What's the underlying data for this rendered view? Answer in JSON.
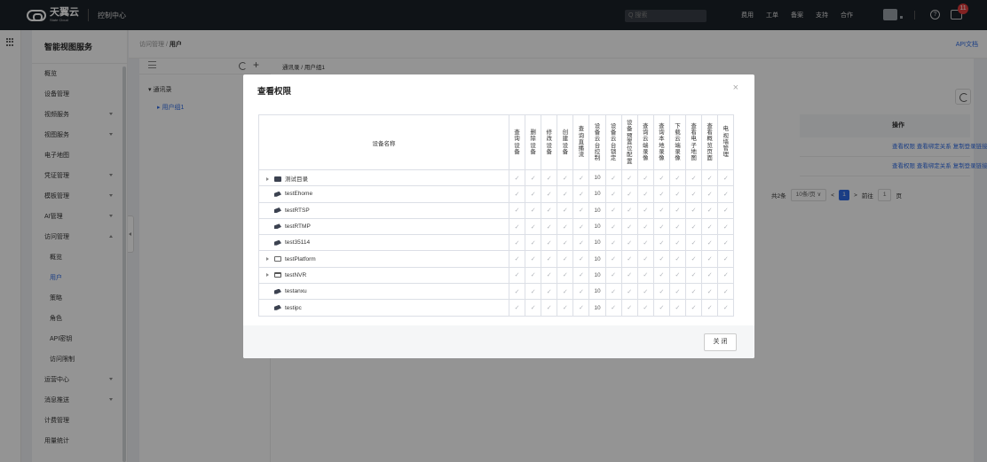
{
  "topbar": {
    "brand_cn": "天翼云",
    "brand_en": "State Cloud",
    "console": "控制中心",
    "search_placeholder": "搜索",
    "nav": [
      "费用",
      "工单",
      "备案",
      "支持",
      "合作"
    ],
    "help_glyph": "?",
    "msg_badge": "11"
  },
  "sidebar": {
    "title": "智能视图服务",
    "items": [
      {
        "label": "概览",
        "sub": false,
        "caret": ""
      },
      {
        "label": "设备管理",
        "sub": false,
        "caret": ""
      },
      {
        "label": "视频服务",
        "sub": false,
        "caret": "down"
      },
      {
        "label": "视图服务",
        "sub": false,
        "caret": "down"
      },
      {
        "label": "电子地图",
        "sub": false,
        "caret": ""
      },
      {
        "label": "凭证管理",
        "sub": false,
        "caret": "down"
      },
      {
        "label": "模板管理",
        "sub": false,
        "caret": "down"
      },
      {
        "label": "AI管理",
        "sub": false,
        "caret": "down"
      },
      {
        "label": "访问管理",
        "sub": false,
        "caret": "up"
      },
      {
        "label": "概览",
        "sub": true,
        "caret": ""
      },
      {
        "label": "用户",
        "sub": true,
        "caret": "",
        "active": true
      },
      {
        "label": "策略",
        "sub": true,
        "caret": ""
      },
      {
        "label": "角色",
        "sub": true,
        "caret": ""
      },
      {
        "label": "API密钥",
        "sub": true,
        "caret": ""
      },
      {
        "label": "访问限制",
        "sub": true,
        "caret": ""
      },
      {
        "label": "运营中心",
        "sub": false,
        "caret": "down"
      },
      {
        "label": "消息推送",
        "sub": false,
        "caret": "down"
      },
      {
        "label": "计费管理",
        "sub": false,
        "caret": ""
      },
      {
        "label": "用量统计",
        "sub": false,
        "caret": ""
      }
    ]
  },
  "breadcrumb": {
    "parent": "访问管理",
    "sep": " / ",
    "current": "用户"
  },
  "api_doc": "API文档",
  "tree": {
    "crumb": "通讯录 / 用户组1",
    "root": "▾  通讯录",
    "child": "▸  用户组1"
  },
  "bg_table": {
    "op_header": "操作",
    "row_actions": "查看权限    查看绑定关系    复制登录链接    更多 ∨"
  },
  "pager": {
    "total": "共2条",
    "page_size": "10条/页  ∨",
    "prev": "<",
    "page": "1",
    "next": ">",
    "goto": "前往",
    "goto_val": "1",
    "page_suffix": "页"
  },
  "modal": {
    "title": "查看权限",
    "close_glyph": "×",
    "name_header": "设备名称",
    "columns": [
      "查询设备",
      "删除设备",
      "修改设备",
      "创建设备",
      "查询直播流",
      "设备云台控制",
      "设备云台锁定",
      "设备预置位配置",
      "查询云端录像",
      "查询本地录像",
      "下载云端录像",
      "查看电子地图",
      "查看概览页面",
      "电视墙管理"
    ],
    "check_glyph": "✓",
    "rows": [
      {
        "name": "测试目录",
        "icon": "folder-icon",
        "expand": true,
        "value": "10"
      },
      {
        "name": "testEhome",
        "icon": "camera-icon",
        "expand": false,
        "value": "10"
      },
      {
        "name": "testRTSP",
        "icon": "camera-icon",
        "expand": false,
        "value": "10"
      },
      {
        "name": "testRTMP",
        "icon": "camera-icon",
        "expand": false,
        "value": "10"
      },
      {
        "name": "test35114",
        "icon": "camera-icon",
        "expand": false,
        "value": "10"
      },
      {
        "name": "testPlatform",
        "icon": "platform-icon",
        "expand": true,
        "value": "10"
      },
      {
        "name": "testNVR",
        "icon": "nvr-icon",
        "expand": true,
        "value": "10"
      },
      {
        "name": "testanxu",
        "icon": "camera-icon",
        "expand": false,
        "value": "10"
      },
      {
        "name": "testipc",
        "icon": "camera-icon",
        "expand": false,
        "value": "10"
      }
    ],
    "close_button": "关 闭"
  }
}
